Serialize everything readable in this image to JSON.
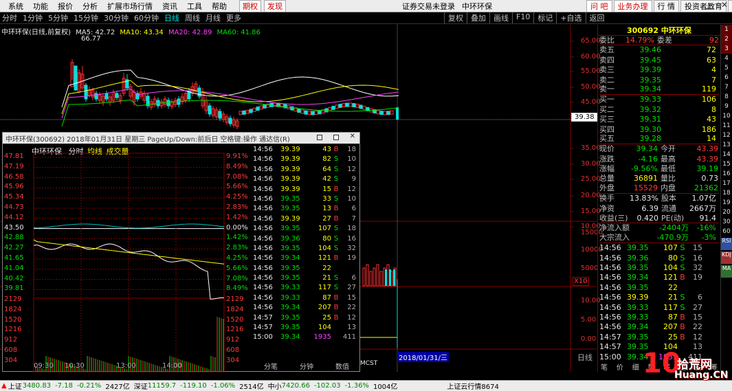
{
  "top_menu": {
    "items": [
      "系统",
      "功能",
      "报价",
      "分析",
      "扩展市场行情",
      "资讯",
      "工具",
      "帮助"
    ],
    "extras": [
      "期权",
      "发现"
    ],
    "center": [
      "证券交易未登录",
      "中环环保"
    ],
    "right": [
      "问 吧",
      "业务办理",
      "行 情",
      "投资者教育",
      "交 易",
      "网 站"
    ]
  },
  "period_bar": {
    "tabs": [
      "分时",
      "1分钟",
      "5分钟",
      "15分钟",
      "30分钟",
      "60分钟",
      "日线",
      "周线",
      "月线",
      "更多"
    ],
    "tools": [
      "复权",
      "叠加",
      "画线",
      "F10",
      "标记",
      "+自选",
      "返回"
    ],
    "date_range": "2018/01/31/三",
    "bottom_right": "日线",
    "x10": "X10",
    "mcst": "MCST"
  },
  "kline": {
    "title": "中环环保(日线,前复权)",
    "ma5": "MA5: 42.72",
    "ma10": "MA10: 43.34",
    "ma20": "MA20: 42.89",
    "ma60": "MA60: 41.86",
    "high_label": "66.77",
    "price_ticks": [
      "65.00",
      "60.00",
      "55.00",
      "50.00",
      "45.00",
      "35.00",
      "30.00",
      "25.00",
      "20.00",
      "15.00",
      "10.00"
    ],
    "last_price": "39.38",
    "vol_ticks": [
      "15000",
      "10000",
      "5000"
    ],
    "macd_ticks": [
      "10.00",
      "5.00",
      "0.00"
    ],
    "colors": {
      "ma5": "#ffffff",
      "ma10": "#ffff00",
      "ma20": "#ff40ff",
      "ma60": "#00e000"
    }
  },
  "popup": {
    "title": "中环环保(300692) 2018年01月31日 星期三 PageUp/Down:前后日 空格键:操作 通达信(R)",
    "tabs": [
      "中环环保",
      "分时",
      "均线",
      "成交量"
    ],
    "left_prices": [
      "47.81",
      "47.19",
      "46.58",
      "45.96",
      "45.34",
      "44.73",
      "44.12",
      "43.50",
      "42.88",
      "42.27",
      "41.65",
      "41.04",
      "40.42",
      "39.81"
    ],
    "right_pcts": [
      "9.91%",
      "8.49%",
      "7.08%",
      "5.66%",
      "4.25%",
      "2.83%",
      "1.42%",
      "0.00%",
      "1.42%",
      "2.83%",
      "4.25%",
      "5.66%",
      "7.08%",
      "8.49%"
    ],
    "vol_ticks": [
      "2129",
      "1824",
      "1520",
      "1216",
      "912",
      "608",
      "304"
    ],
    "times": [
      "09:30",
      "10:30",
      "13:00",
      "14:00"
    ]
  },
  "ticks_mid": [
    [
      "14:56",
      "39.39",
      "43",
      "B",
      "18"
    ],
    [
      "14:56",
      "39.39",
      "82",
      "S",
      "10"
    ],
    [
      "14:56",
      "39.39",
      "64",
      "S",
      "12"
    ],
    [
      "14:56",
      "39.39",
      "42",
      "S",
      "9"
    ],
    [
      "14:56",
      "39.39",
      "15",
      "B",
      "12"
    ],
    [
      "14:56",
      "39.35",
      "33",
      "S",
      "10"
    ],
    [
      "14:56",
      "39.35",
      "13",
      "B",
      "6"
    ],
    [
      "14:56",
      "39.39",
      "27",
      "B",
      "7"
    ],
    [
      "14:56",
      "39.35",
      "107",
      "S",
      "18"
    ],
    [
      "14:56",
      "39.36",
      "80",
      "S",
      "16"
    ],
    [
      "14:56",
      "39.35",
      "104",
      "S",
      "32"
    ],
    [
      "14:56",
      "39.34",
      "121",
      "B",
      "19"
    ],
    [
      "14:56",
      "39.35",
      "22",
      "",
      ""
    ],
    [
      "14:56",
      "39.35",
      "21",
      "S",
      "6"
    ],
    [
      "14:56",
      "39.33",
      "117",
      "S",
      "27"
    ],
    [
      "14:56",
      "39.33",
      "87",
      "B",
      "15"
    ],
    [
      "14:56",
      "39.34",
      "207",
      "B",
      "22"
    ],
    [
      "14:57",
      "39.35",
      "25",
      "B",
      "12"
    ],
    [
      "14:57",
      "39.35",
      "104",
      "",
      "13"
    ],
    [
      "15:00",
      "39.34",
      "1935",
      "",
      "411"
    ]
  ],
  "quote": {
    "header": "300692 中环环保",
    "wei_bi": "委比",
    "wei_bi_val": "14.79%",
    "wei_cha": "委差",
    "wei_cha_val": "92",
    "asks": [
      [
        "卖五",
        "39.46",
        "72"
      ],
      [
        "卖四",
        "39.45",
        "63"
      ],
      [
        "卖三",
        "39.39",
        "4"
      ],
      [
        "卖二",
        "39.35",
        "7"
      ],
      [
        "卖一",
        "39.34",
        "119"
      ]
    ],
    "bids": [
      [
        "买一",
        "39.33",
        "106"
      ],
      [
        "买二",
        "39.32",
        "8"
      ],
      [
        "买三",
        "39.31",
        "43"
      ],
      [
        "买四",
        "39.30",
        "186"
      ],
      [
        "买五",
        "39.28",
        "14"
      ]
    ],
    "stats": [
      [
        "现价",
        "39.34",
        "今开",
        "43.39"
      ],
      [
        "涨跌",
        "-4.16",
        "最高",
        "43.39"
      ],
      [
        "涨幅",
        "-9.56%",
        "最低",
        "39.19"
      ],
      [
        "总量",
        "36891",
        "量比",
        "0.73"
      ],
      [
        "外盘",
        "15529",
        "内盘",
        "21362"
      ]
    ],
    "stats2": [
      [
        "换手",
        "13.83%",
        "股本",
        "1.07亿"
      ],
      [
        "净资",
        "6.39",
        "流通",
        "2667万"
      ],
      [
        "收益(三)",
        "0.420",
        "PE(动)",
        "91.4"
      ]
    ],
    "flow": [
      [
        "净流入额",
        "-2404万",
        "-16%"
      ],
      [
        "大宗流入",
        "-470.9万",
        "-3%"
      ]
    ],
    "bottom_tabs": [
      "笔",
      "价",
      "细",
      "势",
      "联",
      "值",
      "主",
      "筹"
    ]
  },
  "ticks_right": [
    [
      "14:56",
      "39.35",
      "107",
      "S",
      "15"
    ],
    [
      "14:56",
      "39.36",
      "80",
      "S",
      "16"
    ],
    [
      "14:56",
      "39.35",
      "104",
      "S",
      "32"
    ],
    [
      "14:56",
      "39.34",
      "121",
      "B",
      "19"
    ],
    [
      "14:56",
      "39.35",
      "22",
      "",
      ""
    ],
    [
      "14:56",
      "39.39",
      "21",
      "S",
      "6"
    ],
    [
      "14:56",
      "39.33",
      "117",
      "S",
      "27"
    ],
    [
      "14:56",
      "39.33",
      "87",
      "B",
      "15"
    ],
    [
      "14:56",
      "39.34",
      "207",
      "B",
      "22"
    ],
    [
      "14:57",
      "39.35",
      "25",
      "B",
      "12"
    ],
    [
      "14:57",
      "39.35",
      "104",
      "",
      "13"
    ],
    [
      "15:00",
      "39.34",
      "1935",
      "",
      "411"
    ]
  ],
  "right_tabs": [
    "1",
    "2",
    "3",
    "4",
    "5",
    "6",
    "7",
    "8",
    "9",
    "10",
    "11",
    "12",
    "13",
    "14",
    "15",
    "16",
    "17",
    "18",
    "19",
    "20",
    "30",
    "60"
  ],
  "side_icons": [
    "RSI",
    "KDJ",
    "MA"
  ],
  "mid_tabs": [
    "分笔",
    "分钟",
    "数值"
  ],
  "status": {
    "sh": "上证",
    "sh_val": "3480.83",
    "sh_chg": "-7.18",
    "sh_pct": "-0.21%",
    "sh_amt": "2427亿",
    "sz": "深证",
    "sz_val": "11159.7",
    "sz_chg": "-119.10",
    "sz_pct": "-1.06%",
    "sz_amt": "2514亿",
    "zx": "中小",
    "zx_val": "7420.66",
    "zx_chg": "-102.03",
    "zx_pct": "-1.36%",
    "zx_amt": "1004亿",
    "cloud": "上证云行情8674"
  },
  "watermark": {
    "big": "10",
    "cn": "拾荒网",
    "url": "Huang.CN"
  }
}
